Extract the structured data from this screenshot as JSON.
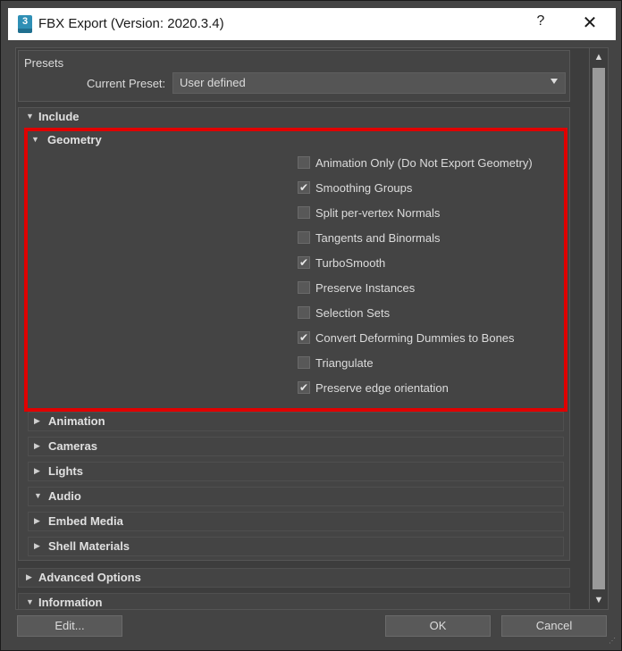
{
  "window": {
    "title": "FBX Export (Version: 2020.3.4)",
    "app_icon_text": "3",
    "help": "?",
    "close": "✕"
  },
  "presets": {
    "group_label": "Presets",
    "current_label": "Current Preset:",
    "current_value": "User defined"
  },
  "include": {
    "label": "Include",
    "geometry": {
      "label": "Geometry",
      "options": [
        {
          "label": "Animation Only (Do Not Export Geometry)",
          "checked": false
        },
        {
          "label": "Smoothing Groups",
          "checked": true
        },
        {
          "label": "Split per-vertex Normals",
          "checked": false
        },
        {
          "label": "Tangents and Binormals",
          "checked": false
        },
        {
          "label": "TurboSmooth",
          "checked": true
        },
        {
          "label": "Preserve Instances",
          "checked": false
        },
        {
          "label": "Selection Sets",
          "checked": false
        },
        {
          "label": "Convert Deforming Dummies to Bones",
          "checked": true
        },
        {
          "label": "Triangulate",
          "checked": false
        },
        {
          "label": "Preserve edge orientation",
          "checked": true
        }
      ]
    },
    "subsections": [
      {
        "label": "Animation",
        "expanded": false
      },
      {
        "label": "Cameras",
        "expanded": false
      },
      {
        "label": "Lights",
        "expanded": false
      },
      {
        "label": "Audio",
        "expanded": true
      },
      {
        "label": "Embed Media",
        "expanded": false
      },
      {
        "label": "Shell Materials",
        "expanded": false
      }
    ]
  },
  "advanced_options": {
    "label": "Advanced Options",
    "expanded": false
  },
  "information": {
    "label": "Information",
    "expanded": true
  },
  "buttons": {
    "edit": "Edit...",
    "ok": "OK",
    "cancel": "Cancel"
  },
  "colors": {
    "highlight": "#e00000",
    "background": "#444444",
    "titlebar": "#ffffff"
  }
}
